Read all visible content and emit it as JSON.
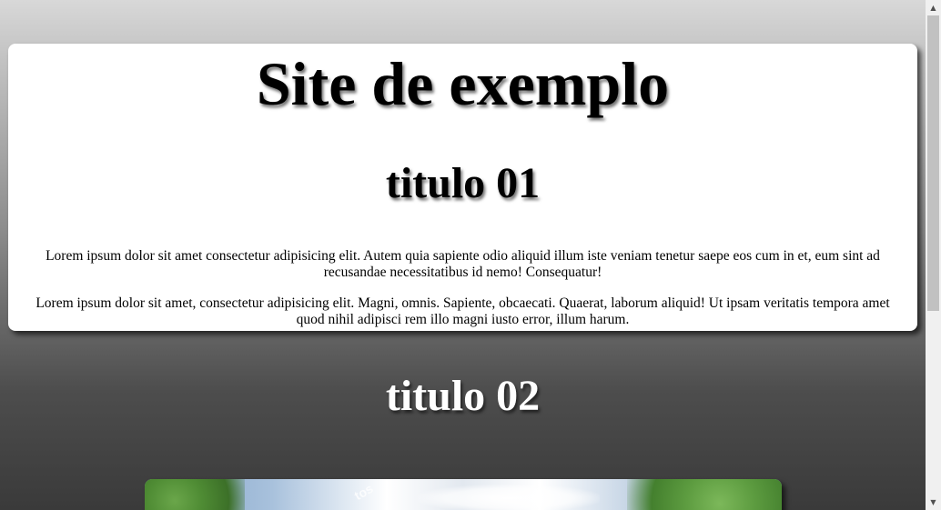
{
  "page": {
    "site_title": "Site de exemplo"
  },
  "section1": {
    "title": "titulo 01",
    "paragraphs": [
      "Lorem ipsum dolor sit amet consectetur adipisicing elit. Autem quia sapiente odio aliquid illum iste veniam tenetur saepe eos cum in et, eum sint ad recusandae necessitatibus id nemo! Consequatur!",
      "Lorem ipsum dolor sit amet, consectetur adipisicing elit. Magni, omnis. Sapiente, obcaecati. Quaerat, laborum aliquid! Ut ipsam veritatis tempora amet quod nihil adipisci rem illo magni iusto error, illum harum."
    ]
  },
  "section2": {
    "title": "titulo 02",
    "image_watermark": "tos"
  },
  "scrollbar": {
    "up_icon": "triangle-up-icon",
    "down_icon": "triangle-down-icon",
    "up_glyph": "▲",
    "down_glyph": "▼"
  }
}
